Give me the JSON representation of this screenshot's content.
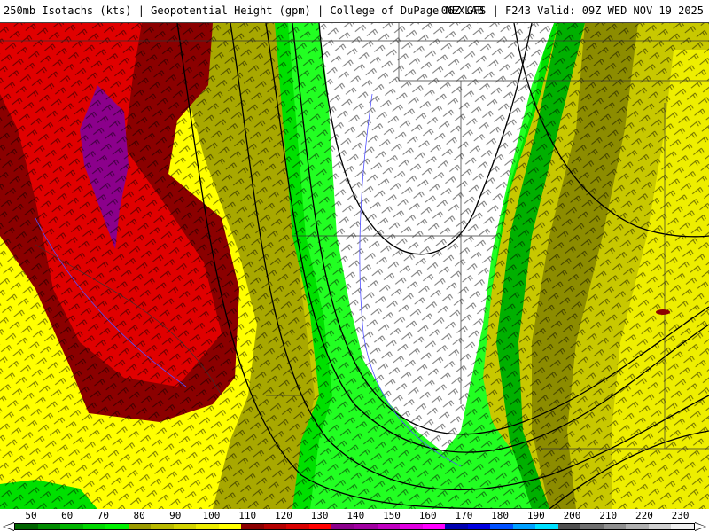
{
  "header": {
    "left": "250mb Isotachs (kts) | Geopotential Height (gpm) | College of DuPage NEXLAB",
    "right": "06Z GFS | F243 Valid: 09Z WED NOV 19 2025"
  },
  "legend": {
    "labels": [
      "50",
      "60",
      "70",
      "80",
      "90",
      "100",
      "110",
      "120",
      "130",
      "140",
      "150",
      "160",
      "170",
      "180",
      "190",
      "200",
      "210",
      "220",
      "230"
    ],
    "colors": [
      "#006400",
      "#008c00",
      "#00b400",
      "#00d700",
      "#00f000",
      "#9b9b00",
      "#b9b900",
      "#d2d200",
      "#ecec00",
      "#ffff00",
      "#8b0000",
      "#b40000",
      "#d80000",
      "#ff0000",
      "#8b008b",
      "#a000a0",
      "#c000c0",
      "#e000e0",
      "#ff00ff",
      "#0000b0",
      "#0000e0",
      "#0050ff",
      "#00a0ff",
      "#00e0ff",
      "#505050",
      "#707070",
      "#909090",
      "#b0b0b0",
      "#d0d0d0",
      "#f0f0f0"
    ]
  },
  "map": {
    "field_colors": {
      "deep_green": "#00b000",
      "green": "#00e000",
      "light_green": "#22ff22",
      "olive_dark": "#8c8c00",
      "olive": "#a8a800",
      "olive_light": "#c8c800",
      "yellow": "#eeee00",
      "bright_yellow": "#ffff00",
      "dark_red": "#8b0000",
      "red": "#e00000",
      "bright_red": "#ff1010",
      "purple": "#8b008b",
      "white": "#ffffff"
    }
  }
}
